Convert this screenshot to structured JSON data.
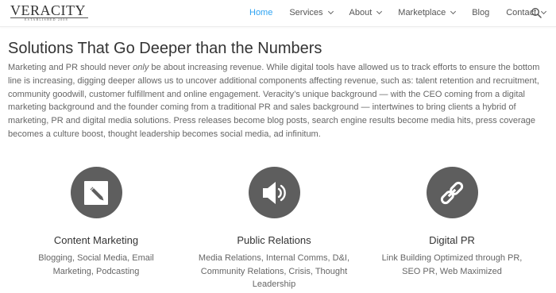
{
  "brand": {
    "logo_text": "VERACITY",
    "logo_subtext": "ESTABLISHED 2008"
  },
  "nav": {
    "items": [
      {
        "label": "Home",
        "has_dropdown": false,
        "active": true
      },
      {
        "label": "Services",
        "has_dropdown": true,
        "active": false
      },
      {
        "label": "About",
        "has_dropdown": true,
        "active": false
      },
      {
        "label": "Marketplace",
        "has_dropdown": true,
        "active": false
      },
      {
        "label": "Blog",
        "has_dropdown": false,
        "active": false
      },
      {
        "label": "Contact",
        "has_dropdown": true,
        "active": false
      }
    ],
    "search_icon": "search-icon",
    "active_color": "#2ea3f2"
  },
  "main": {
    "title": "Solutions That Go Deeper than the Numbers",
    "intro_before_em": "Marketing and PR should never ",
    "intro_em": "only",
    "intro_after_em": " be about increasing revenue. While digital tools have allowed us to track efforts to ensure the bottom line is increasing, digging deeper allows us to uncover additional components affecting revenue, such as: talent retention and recruitment, community goodwill, customer fulfillment and online engagement. Veracity’s unique background — with the CEO coming from a digital marketing background and the founder coming from a traditional PR and sales background — intertwines to bring clients a hybrid of marketing, PR and digital media solutions. Press releases become blog posts, search engine results become media hits, press coverage becomes a culture boost, thought leadership becomes social media, ad infinitum."
  },
  "features": [
    {
      "icon": "pencil-icon",
      "title": "Content Marketing",
      "description": "Blogging, Social Media, Email Marketing, Podcasting"
    },
    {
      "icon": "speaker-icon",
      "title": "Public Relations",
      "description": "Media Relations, Internal Comms, D&I, Community Relations, Crisis, Thought Leadership"
    },
    {
      "icon": "link-icon",
      "title": "Digital PR",
      "description": "Link Building Optimized through PR, SEO PR, Web Maximized"
    }
  ],
  "colors": {
    "icon_circle": "#5e5e5e",
    "heading": "#333333",
    "body_text": "#666666"
  }
}
